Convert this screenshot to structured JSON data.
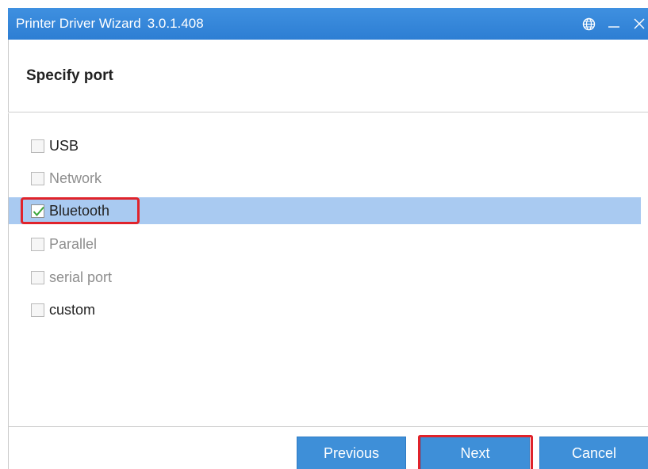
{
  "window": {
    "title": "Printer Driver Wizard",
    "version": "3.0.1.408",
    "controls": [
      "globe-icon",
      "minimize-icon",
      "close-icon"
    ],
    "accent_color": "#3389dc"
  },
  "header": {
    "title": "Specify port"
  },
  "ports": [
    {
      "label": "USB",
      "checked": false,
      "enabled": true
    },
    {
      "label": "Network",
      "checked": false,
      "enabled": false
    },
    {
      "label": "Bluetooth",
      "checked": true,
      "enabled": true,
      "selected": true
    },
    {
      "label": "Parallel",
      "checked": false,
      "enabled": false
    },
    {
      "label": "serial port",
      "checked": false,
      "enabled": false
    },
    {
      "label": "custom",
      "checked": false,
      "enabled": true
    }
  ],
  "buttons": {
    "previous": "Previous",
    "next": "Next",
    "cancel": "Cancel"
  },
  "colors": {
    "selection": "#a9caf1",
    "annotation": "#e0232b",
    "checkmark": "#3aa53a"
  }
}
